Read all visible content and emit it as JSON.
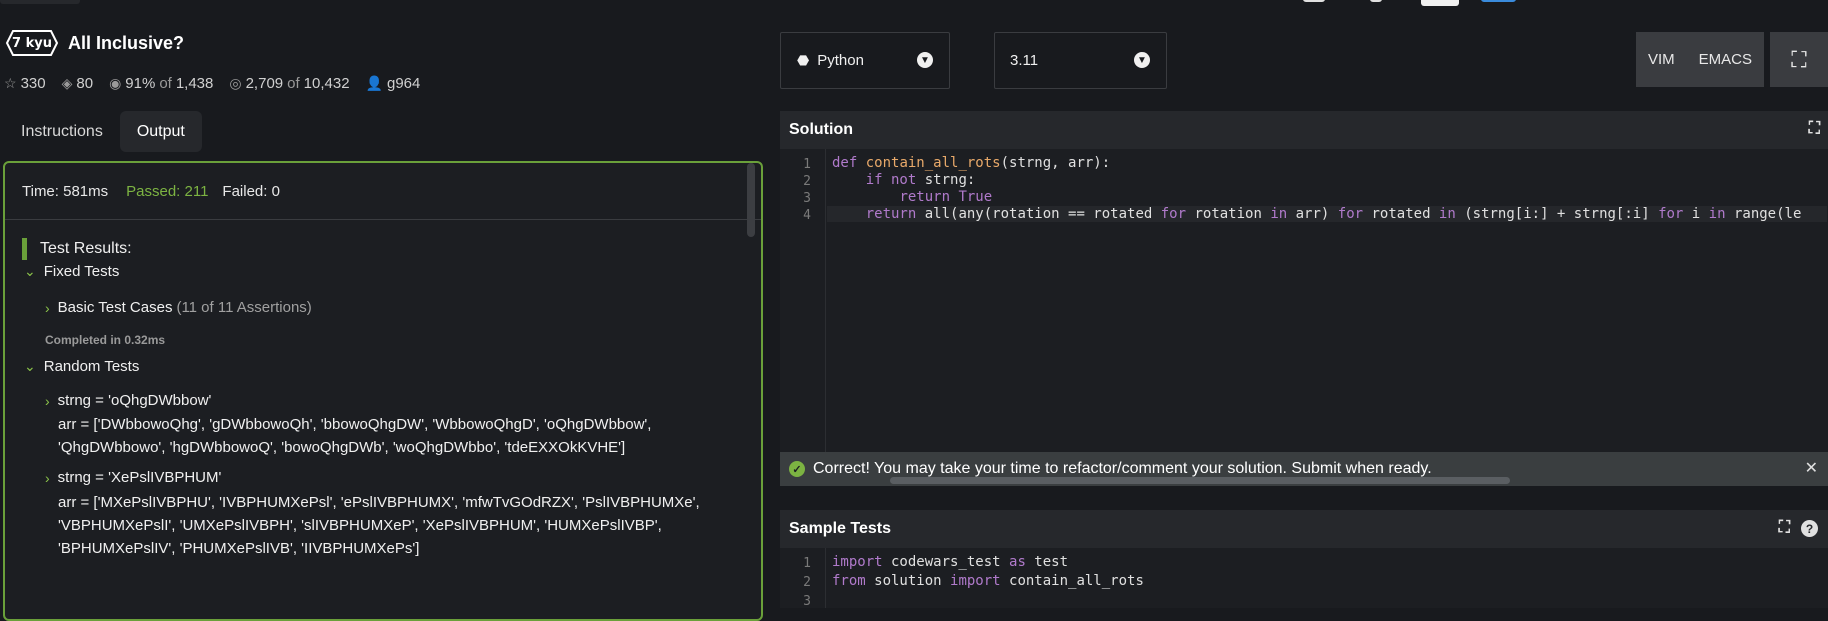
{
  "kata": {
    "rank": "7 kyu",
    "title": "All Inclusive?",
    "stats": {
      "stars": "330",
      "collections": "80",
      "satisfaction_pct": "91%",
      "satisfaction_of": "of",
      "satisfaction_votes": "1,438",
      "completed": "2,709",
      "completed_of": "of",
      "attempts": "10,432",
      "author": "g964"
    }
  },
  "tabs": [
    {
      "label": "Instructions",
      "active": false
    },
    {
      "label": "Output",
      "active": true
    }
  ],
  "output": {
    "time": "Time: 581ms",
    "passed": "Passed: 211",
    "failed": "Failed: 0",
    "results_title": "Test Results:",
    "fixed_tests": "Fixed Tests",
    "basic_test_cases": "Basic Test Cases",
    "basic_assertions": "(11 of 11 Assertions)",
    "completed_in": "Completed in 0.32ms",
    "random_tests": "Random Tests",
    "case1_strng": "strng = 'oQhgDWbbow'",
    "case1_arr_l1": "arr = ['DWbbowoQhg', 'gDWbbowoQh', 'bbowoQhgDW', 'WbbowoQhgD', 'oQhgDWbbow',",
    "case1_arr_l2": "'QhgDWbbowo', 'hgDWbbowoQ', 'bowoQhgDWb', 'woQhgDWbbo', 'tdeEXXOkKVHE']",
    "case2_strng": "strng = 'XePslIVBPHUM'",
    "case2_arr_l1": "arr = ['MXePslIVBPHU', 'IVBPHUMXePsl', 'ePslIVBPHUMX', 'mfwTvGOdRZX', 'PslIVBPHUMXe',",
    "case2_arr_l2": "'VBPHUMXePslI', 'UMXePslIVBPH', 'slIVBPHUMXeP', 'XePslIVBPHUM', 'HUMXePslIVBP',",
    "case2_arr_l3": "'BPHUMXePslIV', 'PHUMXePslIVB', 'IIVBPHUMXePs']"
  },
  "toolbar": {
    "language": "Python",
    "version": "3.11",
    "vim": "VIM",
    "emacs": "EMACS"
  },
  "solution": {
    "title": "Solution",
    "line_numbers": [
      "1",
      "2",
      "3",
      "4"
    ]
  },
  "notice": {
    "text": "Correct! You may take your time to refactor/comment your solution. Submit when ready."
  },
  "sample_tests": {
    "title": "Sample Tests",
    "line_numbers": [
      "1",
      "2",
      "3"
    ],
    "help": "?"
  },
  "icons": {
    "star": "star-icon",
    "layers": "layers-icon",
    "eye": "eye-icon",
    "target": "target-icon",
    "user": "user-icon",
    "python": "python-icon",
    "expand": "expand-icon"
  },
  "colors": {
    "background": "#181a1e",
    "accent_green": "#7cb342",
    "keyword": "#b07acb",
    "function": "#e8a96a"
  }
}
